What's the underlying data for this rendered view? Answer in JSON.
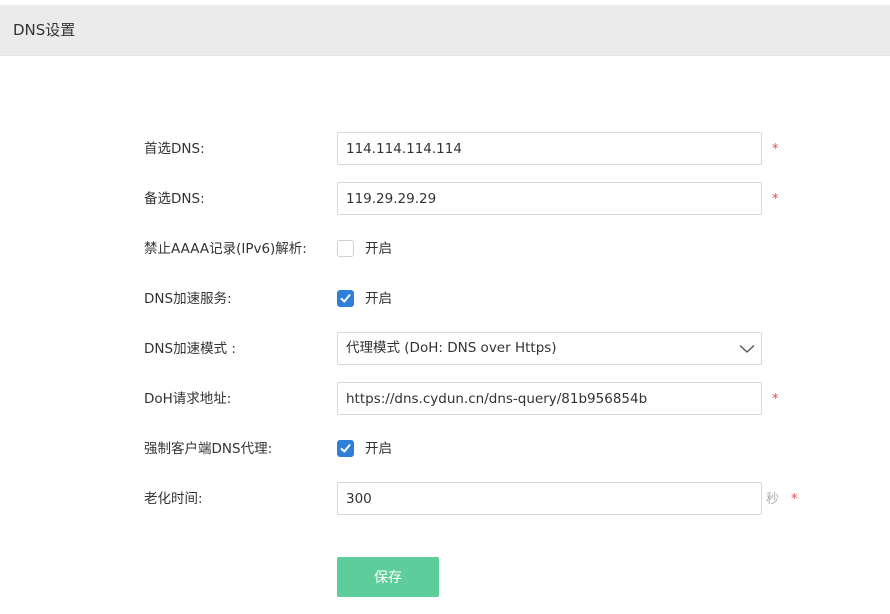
{
  "header": {
    "title": "DNS设置"
  },
  "form": {
    "primary_dns": {
      "label": "首选DNS:",
      "value": "114.114.114.114",
      "required_mark": "*"
    },
    "secondary_dns": {
      "label": "备选DNS:",
      "value": "119.29.29.29",
      "required_mark": "*"
    },
    "disable_aaaa": {
      "label": "禁止AAAA记录(IPv6)解析:",
      "checked": false,
      "option_label": "开启"
    },
    "dns_acceleration": {
      "label": "DNS加速服务:",
      "checked": true,
      "option_label": "开启"
    },
    "acceleration_mode": {
      "label": "DNS加速模式 :",
      "selected": "代理模式 (DoH: DNS over Https)"
    },
    "doh_url": {
      "label": "DoH请求地址:",
      "value": "https://dns.cydun.cn/dns-query/81b956854b",
      "required_mark": "*"
    },
    "force_client_proxy": {
      "label": "强制客户端DNS代理:",
      "checked": true,
      "option_label": "开启"
    },
    "aging_time": {
      "label": "老化时间:",
      "value": "300",
      "unit": "秒",
      "required_mark": "*"
    }
  },
  "actions": {
    "save_label": "保存"
  },
  "colors": {
    "accent_checkbox": "#2f7fd9",
    "save_button": "#5ccd9b",
    "required": "#e64b4b",
    "header_bg": "#ebebeb"
  },
  "icons": {
    "checkbox_check": "checkmark-icon",
    "select_arrow": "chevron-down-icon"
  }
}
